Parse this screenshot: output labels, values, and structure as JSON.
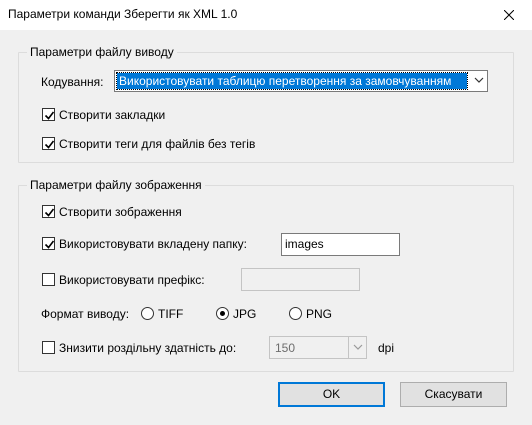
{
  "window": {
    "title": "Параметри команди Зберегти як XML 1.0",
    "close_icon": "close-icon"
  },
  "output_group": {
    "title": "Параметри файлу виводу",
    "encoding_label": "Кодування:",
    "encoding_value": "Використовувати таблицю перетворення за замовчуванням",
    "create_bookmarks_label": "Створити закладки",
    "create_bookmarks_checked": true,
    "create_tags_label": "Створити теги для файлів без тегів",
    "create_tags_checked": true
  },
  "image_group": {
    "title": "Параметри файлу зображення",
    "create_images_label": "Створити зображення",
    "create_images_checked": true,
    "use_subfolder_label": "Використовувати вкладену папку:",
    "use_subfolder_checked": true,
    "subfolder_value": "images",
    "use_prefix_label": "Використовувати префікс:",
    "use_prefix_checked": false,
    "prefix_value": "",
    "format_label": "Формат виводу:",
    "formats": [
      {
        "label": "TIFF",
        "selected": false
      },
      {
        "label": "JPG",
        "selected": true
      },
      {
        "label": "PNG",
        "selected": false
      }
    ],
    "downsample_label": "Знизити роздільну здатність до:",
    "downsample_checked": false,
    "dpi_value": "150",
    "dpi_unit": "dpi"
  },
  "buttons": {
    "ok": "OK",
    "cancel": "Скасувати"
  }
}
